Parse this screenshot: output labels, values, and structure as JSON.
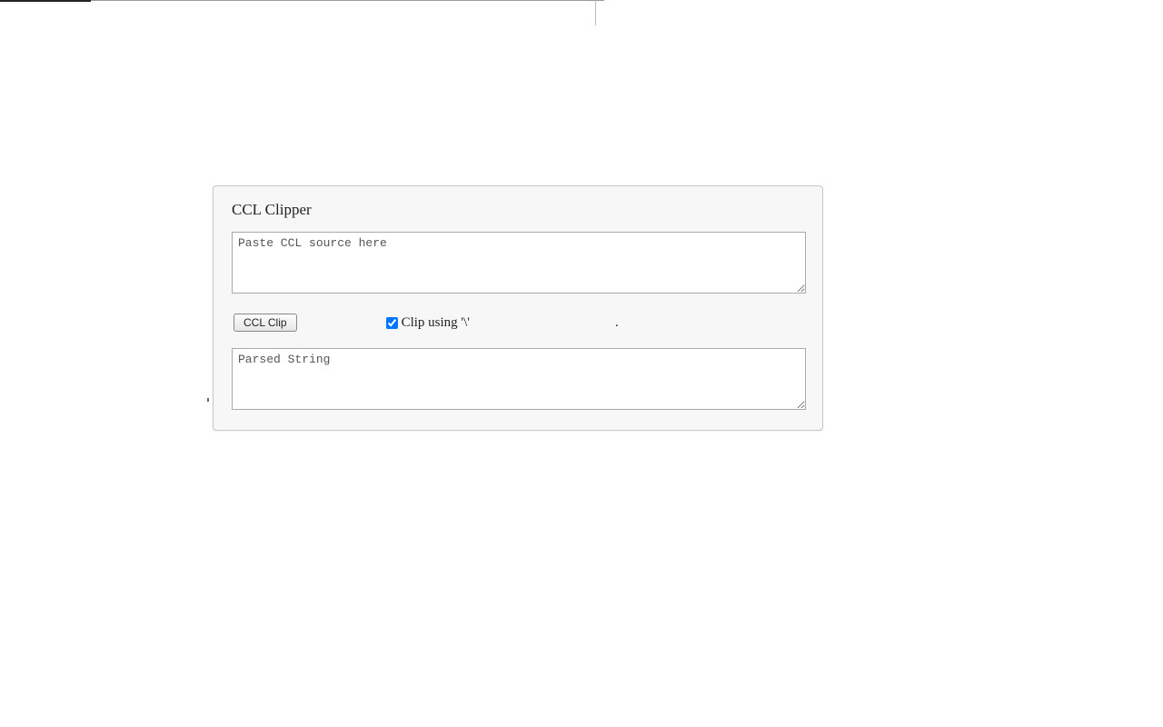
{
  "panel": {
    "title": "CCL Clipper",
    "source_placeholder": "Paste CCL source here",
    "source_value": "",
    "clip_button_label": "CCL Clip",
    "checkbox_label": "Clip using '\\'",
    "checkbox_checked": true,
    "trailing_dot": ".",
    "output_placeholder": "Parsed String",
    "output_value": ""
  }
}
